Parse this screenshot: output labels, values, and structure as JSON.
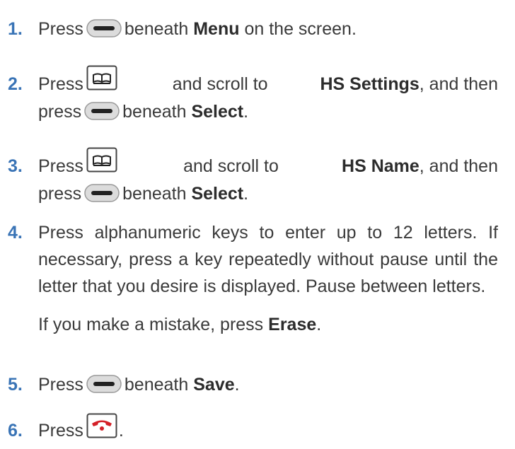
{
  "colors": {
    "step_number": "#3a74b6",
    "text": "#3a3a3a",
    "end_call_red": "#d42027"
  },
  "icons": {
    "soft_key": "soft-key-icon",
    "directory_key": "directory-key-icon",
    "end_call_key": "end-call-key-icon"
  },
  "steps": [
    {
      "number": "1.",
      "pre": "Press",
      "post": "beneath",
      "bold": "Menu",
      "tail": "on the screen."
    },
    {
      "number": "2.",
      "pre": "Press",
      "post": "and scroll to",
      "bold": "HS Settings",
      "tail": ", and then",
      "line2_pre": "press",
      "line2_post": "beneath",
      "line2_bold": "Select",
      "line2_tail": "."
    },
    {
      "number": "3.",
      "pre": "Press",
      "post": "and scroll to",
      "bold": "HS Name",
      "tail": ", and then",
      "line2_pre": "press",
      "line2_post": "beneath",
      "line2_bold": "Select",
      "line2_tail": "."
    },
    {
      "number": "4.",
      "text": "Press alphanumeric keys to enter up to 12 letters. If necessary, press a key repeatedly without pause until the letter that you desire is displayed. Pause between letters.",
      "note_pre": "If you make a mistake, press",
      "note_bold": "Erase",
      "note_tail": "."
    },
    {
      "number": "5.",
      "pre": "Press",
      "post": "beneath",
      "bold": "Save",
      "tail": "."
    },
    {
      "number": "6.",
      "pre": "Press",
      "tail": "."
    }
  ]
}
